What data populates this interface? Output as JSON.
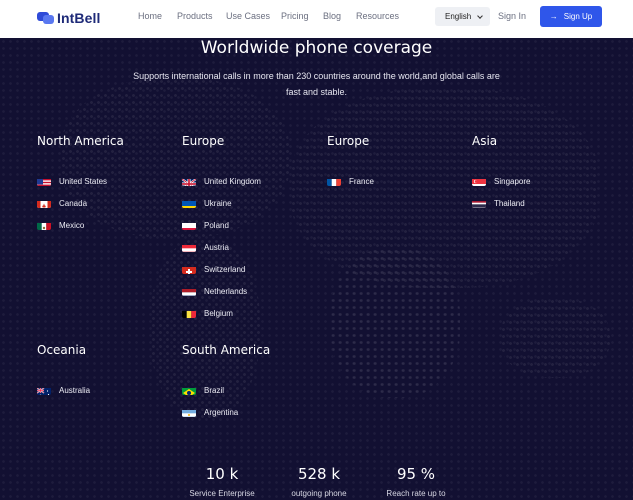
{
  "header": {
    "logo_text": "IntBell",
    "nav": [
      "Home",
      "Products",
      "Use Cases",
      "Pricing",
      "Blog",
      "Resources"
    ],
    "language": "English",
    "sign_in": "Sign In",
    "sign_up": "Sign Up",
    "accent_color": "#2f56ea"
  },
  "hero": {
    "title": "Worldwide phone coverage",
    "subtitle": "Supports international calls in more than 230 countries around the world,and global calls are fast and stable."
  },
  "regions": [
    {
      "name": "North America",
      "countries": [
        {
          "name": "United States",
          "flag": "us-flag-icon"
        },
        {
          "name": "Canada",
          "flag": "ca-flag-icon"
        },
        {
          "name": "Mexico",
          "flag": "mx-flag-icon"
        }
      ]
    },
    {
      "name": "Europe",
      "countries": [
        {
          "name": "United Kingdom",
          "flag": "gb-flag-icon"
        },
        {
          "name": "Ukraine",
          "flag": "ua-flag-icon"
        },
        {
          "name": "Poland",
          "flag": "pl-flag-icon"
        },
        {
          "name": "Austria",
          "flag": "at-flag-icon"
        },
        {
          "name": "Switzerland",
          "flag": "ch-flag-icon"
        },
        {
          "name": "Netherlands",
          "flag": "nl-flag-icon"
        },
        {
          "name": "Belgium",
          "flag": "be-flag-icon"
        }
      ]
    },
    {
      "name": "Europe",
      "countries": [
        {
          "name": "France",
          "flag": "fr-flag-icon"
        }
      ]
    },
    {
      "name": "Asia",
      "countries": [
        {
          "name": "Singapore",
          "flag": "sg-flag-icon"
        },
        {
          "name": "Thailand",
          "flag": "th-flag-icon"
        }
      ]
    },
    {
      "name": "Oceania",
      "countries": [
        {
          "name": "Australia",
          "flag": "au-flag-icon"
        }
      ]
    },
    {
      "name": "South America",
      "countries": [
        {
          "name": "Brazil",
          "flag": "br-flag-icon"
        },
        {
          "name": "Argentina",
          "flag": "ar-flag-icon"
        }
      ]
    }
  ],
  "stats": [
    {
      "value": "10 k",
      "label": "Service Enterprise"
    },
    {
      "value": "528 k",
      "label": "outgoing phone"
    },
    {
      "value": "95 %",
      "label": "Reach rate up to"
    }
  ]
}
